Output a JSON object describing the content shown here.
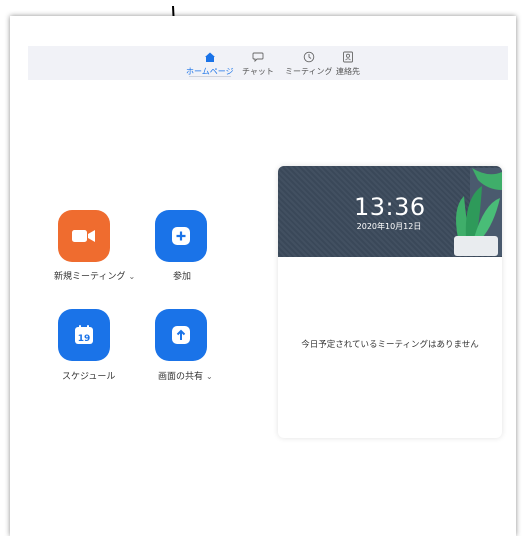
{
  "nav": {
    "home": "ホームページ",
    "chat": "チャット",
    "meetings": "ミーティング",
    "contacts": "連絡先"
  },
  "actions": {
    "new_meeting": "新規ミーティング",
    "join": "参加",
    "schedule": "スケジュール",
    "share_screen": "画面の共有",
    "schedule_day": "19",
    "caret": "⌄"
  },
  "card": {
    "time": "13:36",
    "date": "2020年10月12日",
    "empty_message": "今日予定されているミーティングはありません"
  },
  "colors": {
    "accent": "#1a73e8",
    "orange": "#ef6c2f",
    "header_bg": "#3c4a5c"
  }
}
